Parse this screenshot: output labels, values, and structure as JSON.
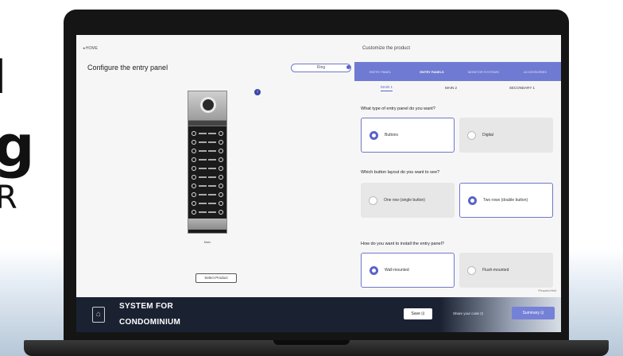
{
  "background": {
    "letters": [
      "I",
      "g",
      "R"
    ]
  },
  "header": {
    "back_link": "◂ HOME",
    "page_title": "Configure the entry panel",
    "top_button": "Ring"
  },
  "device": {
    "info_badge": "i",
    "caption": "Main",
    "select_button": "Select Product"
  },
  "customize": {
    "title": "Customize the product",
    "steps": [
      {
        "label": "ENTRY PANEL",
        "active": false
      },
      {
        "label": "ENTRY PANELS",
        "active": true
      },
      {
        "label": "MONITOR SYSTEMS",
        "active": false
      },
      {
        "label": "ACCESSORIES",
        "active": false
      }
    ],
    "subtabs": [
      {
        "label": "MAIN 1",
        "active": true
      },
      {
        "label": "MAIN 2",
        "active": false
      },
      {
        "label": "SECONDARY 1",
        "active": false
      }
    ],
    "q1": {
      "text": "What type of entry panel do you want?",
      "options": [
        {
          "label": "Buttons",
          "selected": true
        },
        {
          "label": "Digital",
          "selected": false
        }
      ]
    },
    "q2": {
      "text": "Which button layout do you want to see?",
      "options": [
        {
          "label": "One row (single button)",
          "selected": false
        },
        {
          "label": "Two rows (double button)",
          "selected": true
        }
      ]
    },
    "q3": {
      "text": "How do you want to install the entry panel?",
      "options": [
        {
          "label": "Wall-mounted",
          "selected": true
        },
        {
          "label": "Flush-mounted",
          "selected": false
        }
      ]
    },
    "required_note": "*Required field"
  },
  "footer": {
    "brand_line1": "SYSTEM FOR",
    "brand_line2": "CONDOMINIUM",
    "save_button": "Save ⊡",
    "share_link": "Share your code ⊡",
    "summary_button": "Summary ⊡"
  },
  "colors": {
    "accent": "#5a63c8",
    "steps_bar": "#6f7bd2",
    "footer": "#1a2232"
  }
}
